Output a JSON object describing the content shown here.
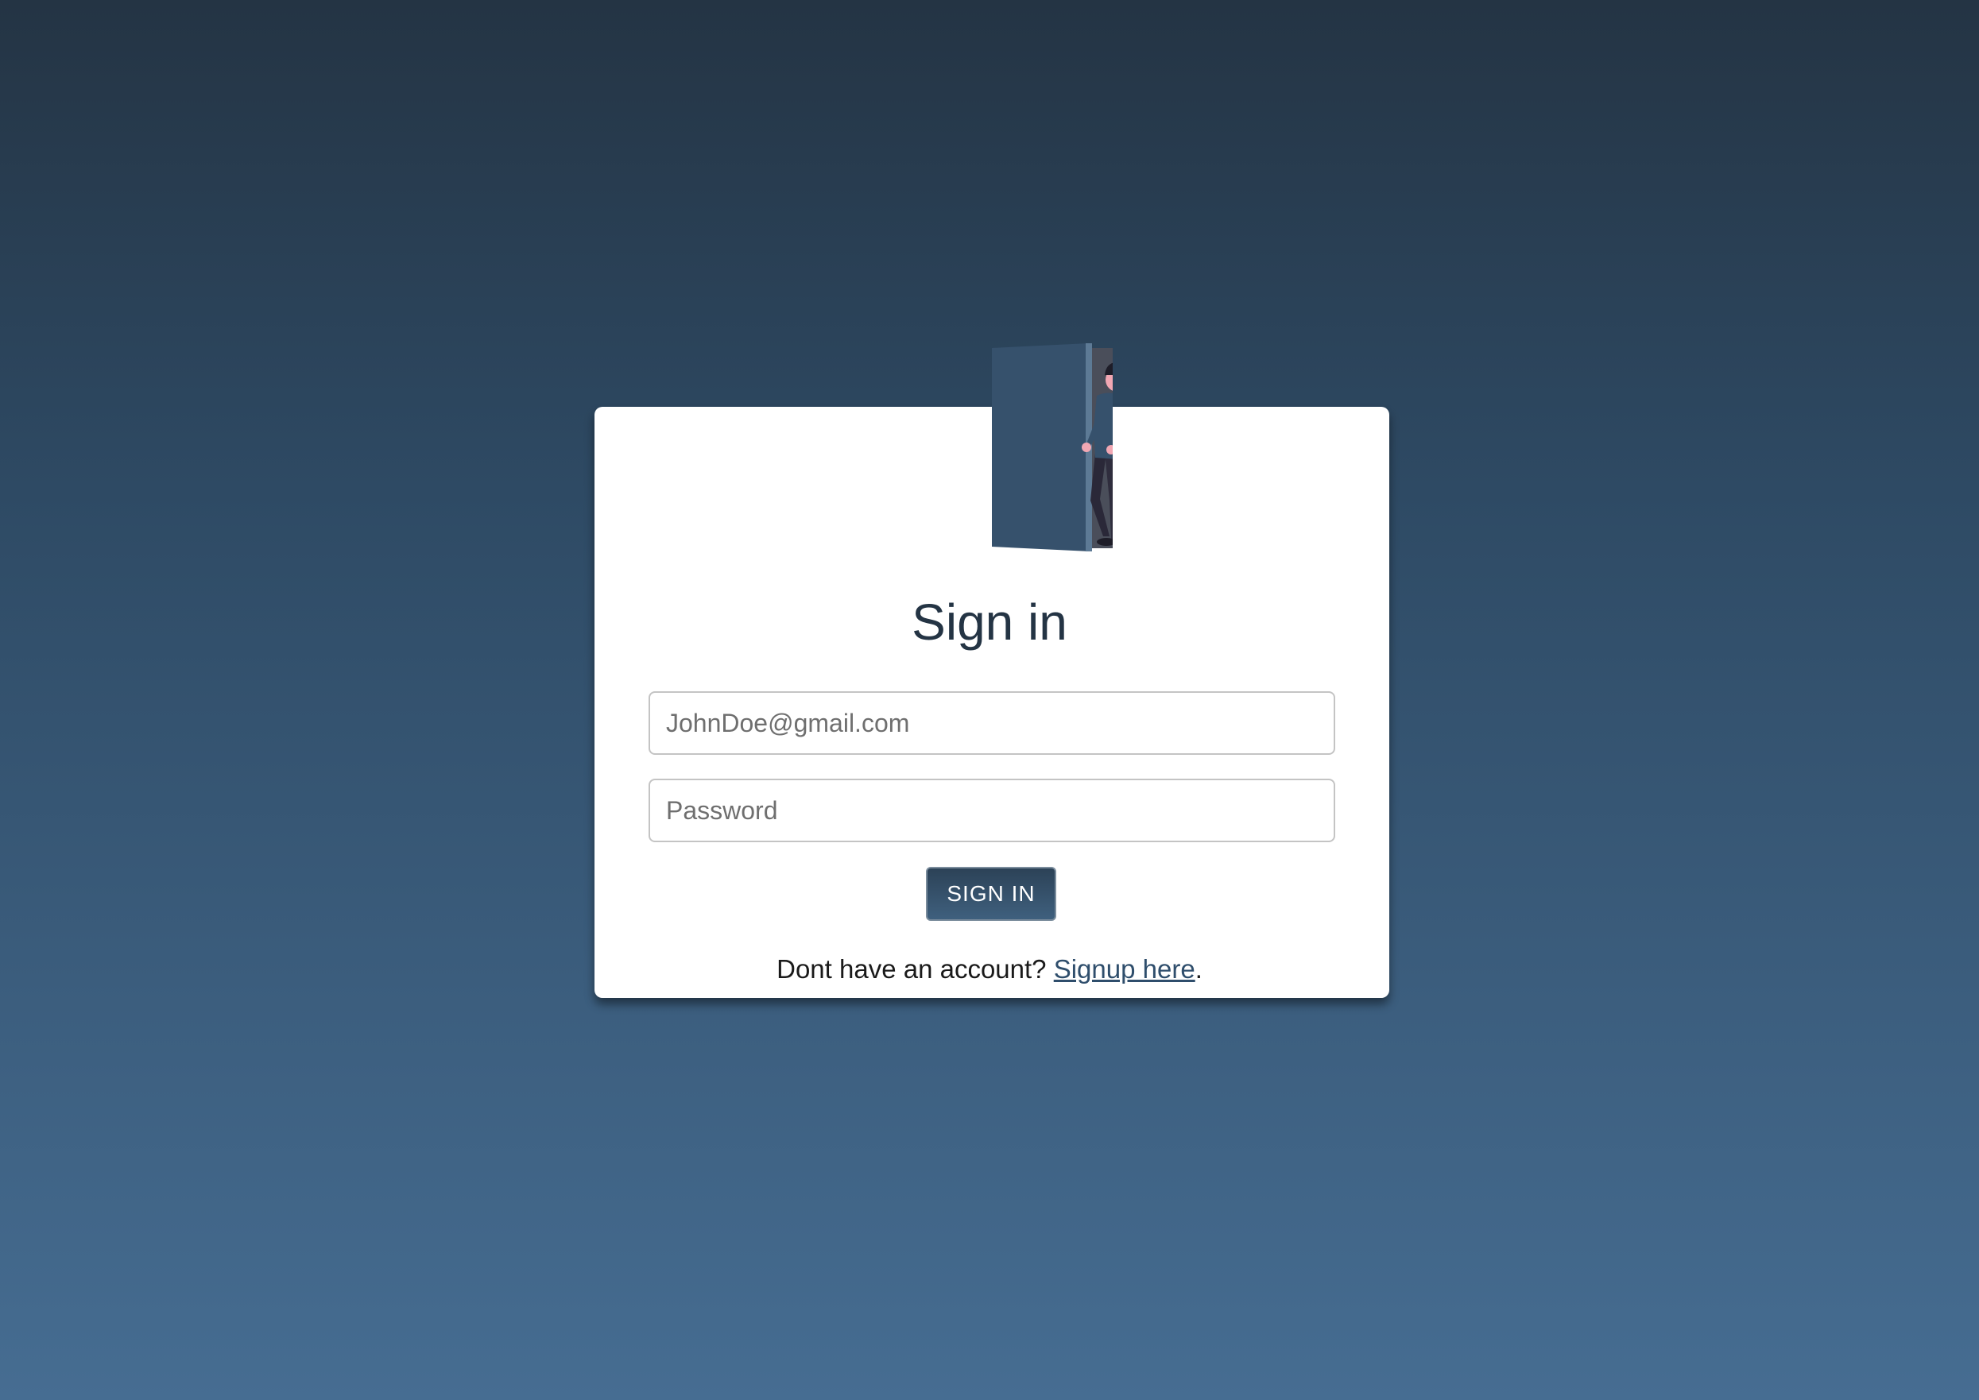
{
  "colors": {
    "background_top": "#243444",
    "background_bottom": "#466d92",
    "card": "#ffffff",
    "primary": "#2f4e6c",
    "title_text": "#243444"
  },
  "illustration": {
    "icon": "person-opening-door-illustration"
  },
  "form": {
    "title": "Sign in",
    "email_placeholder": "JohnDoe@gmail.com",
    "password_placeholder": "Password",
    "submit_label": "SIGN IN"
  },
  "footer": {
    "prompt_text": "Dont have an account?",
    "signup_link_label": "Signup here",
    "trailing_punctuation": "."
  }
}
